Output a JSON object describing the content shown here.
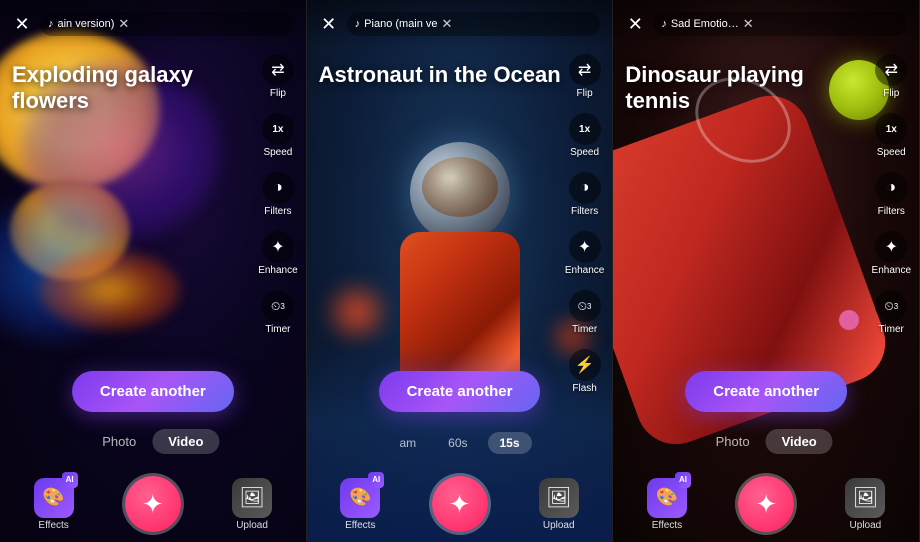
{
  "panels": [
    {
      "id": "panel-1",
      "title": "Exploding galaxy flowers",
      "music": "ain version)",
      "close_visible": true,
      "create_another": "Create another",
      "tabs_type": "media",
      "tabs": [
        {
          "label": "Photo",
          "active": false
        },
        {
          "label": "Video",
          "active": true
        }
      ],
      "bottom": {
        "effects_label": "Effects",
        "upload_label": "Upload"
      }
    },
    {
      "id": "panel-2",
      "title": "Astronaut in the Ocean",
      "music": "Piano (main ve",
      "close_visible": true,
      "create_another": "Create another",
      "tabs_type": "duration",
      "tabs": [
        {
          "label": "am",
          "active": false
        },
        {
          "label": "60s",
          "active": false
        },
        {
          "label": "15s",
          "active": true
        }
      ],
      "bottom": {
        "effects_label": "Effects",
        "upload_label": "Upload"
      }
    },
    {
      "id": "panel-3",
      "title": "Dinosaur playing tennis",
      "music": "Sad Emotio…",
      "close_visible": true,
      "create_another": "Create another",
      "tabs_type": "media",
      "tabs": [
        {
          "label": "Photo",
          "active": false
        },
        {
          "label": "Video",
          "active": true
        }
      ],
      "bottom": {
        "effects_label": "Effects",
        "upload_label": "Upload"
      }
    }
  ],
  "toolbar": {
    "flip_label": "Flip",
    "speed_label": "Speed",
    "speed_value": "1x",
    "filters_label": "Filters",
    "enhance_label": "Enhance",
    "timer_label": "Timer",
    "timer_value": "3",
    "flash_label": "Flash"
  },
  "icons": {
    "close": "✕",
    "music_note": "♪",
    "flip": "⇄",
    "speed": "⏱",
    "filters": "◑",
    "enhance": "✦",
    "timer": "⏲",
    "flash": "⚡",
    "ai": "AI",
    "capture_star": "✦"
  }
}
